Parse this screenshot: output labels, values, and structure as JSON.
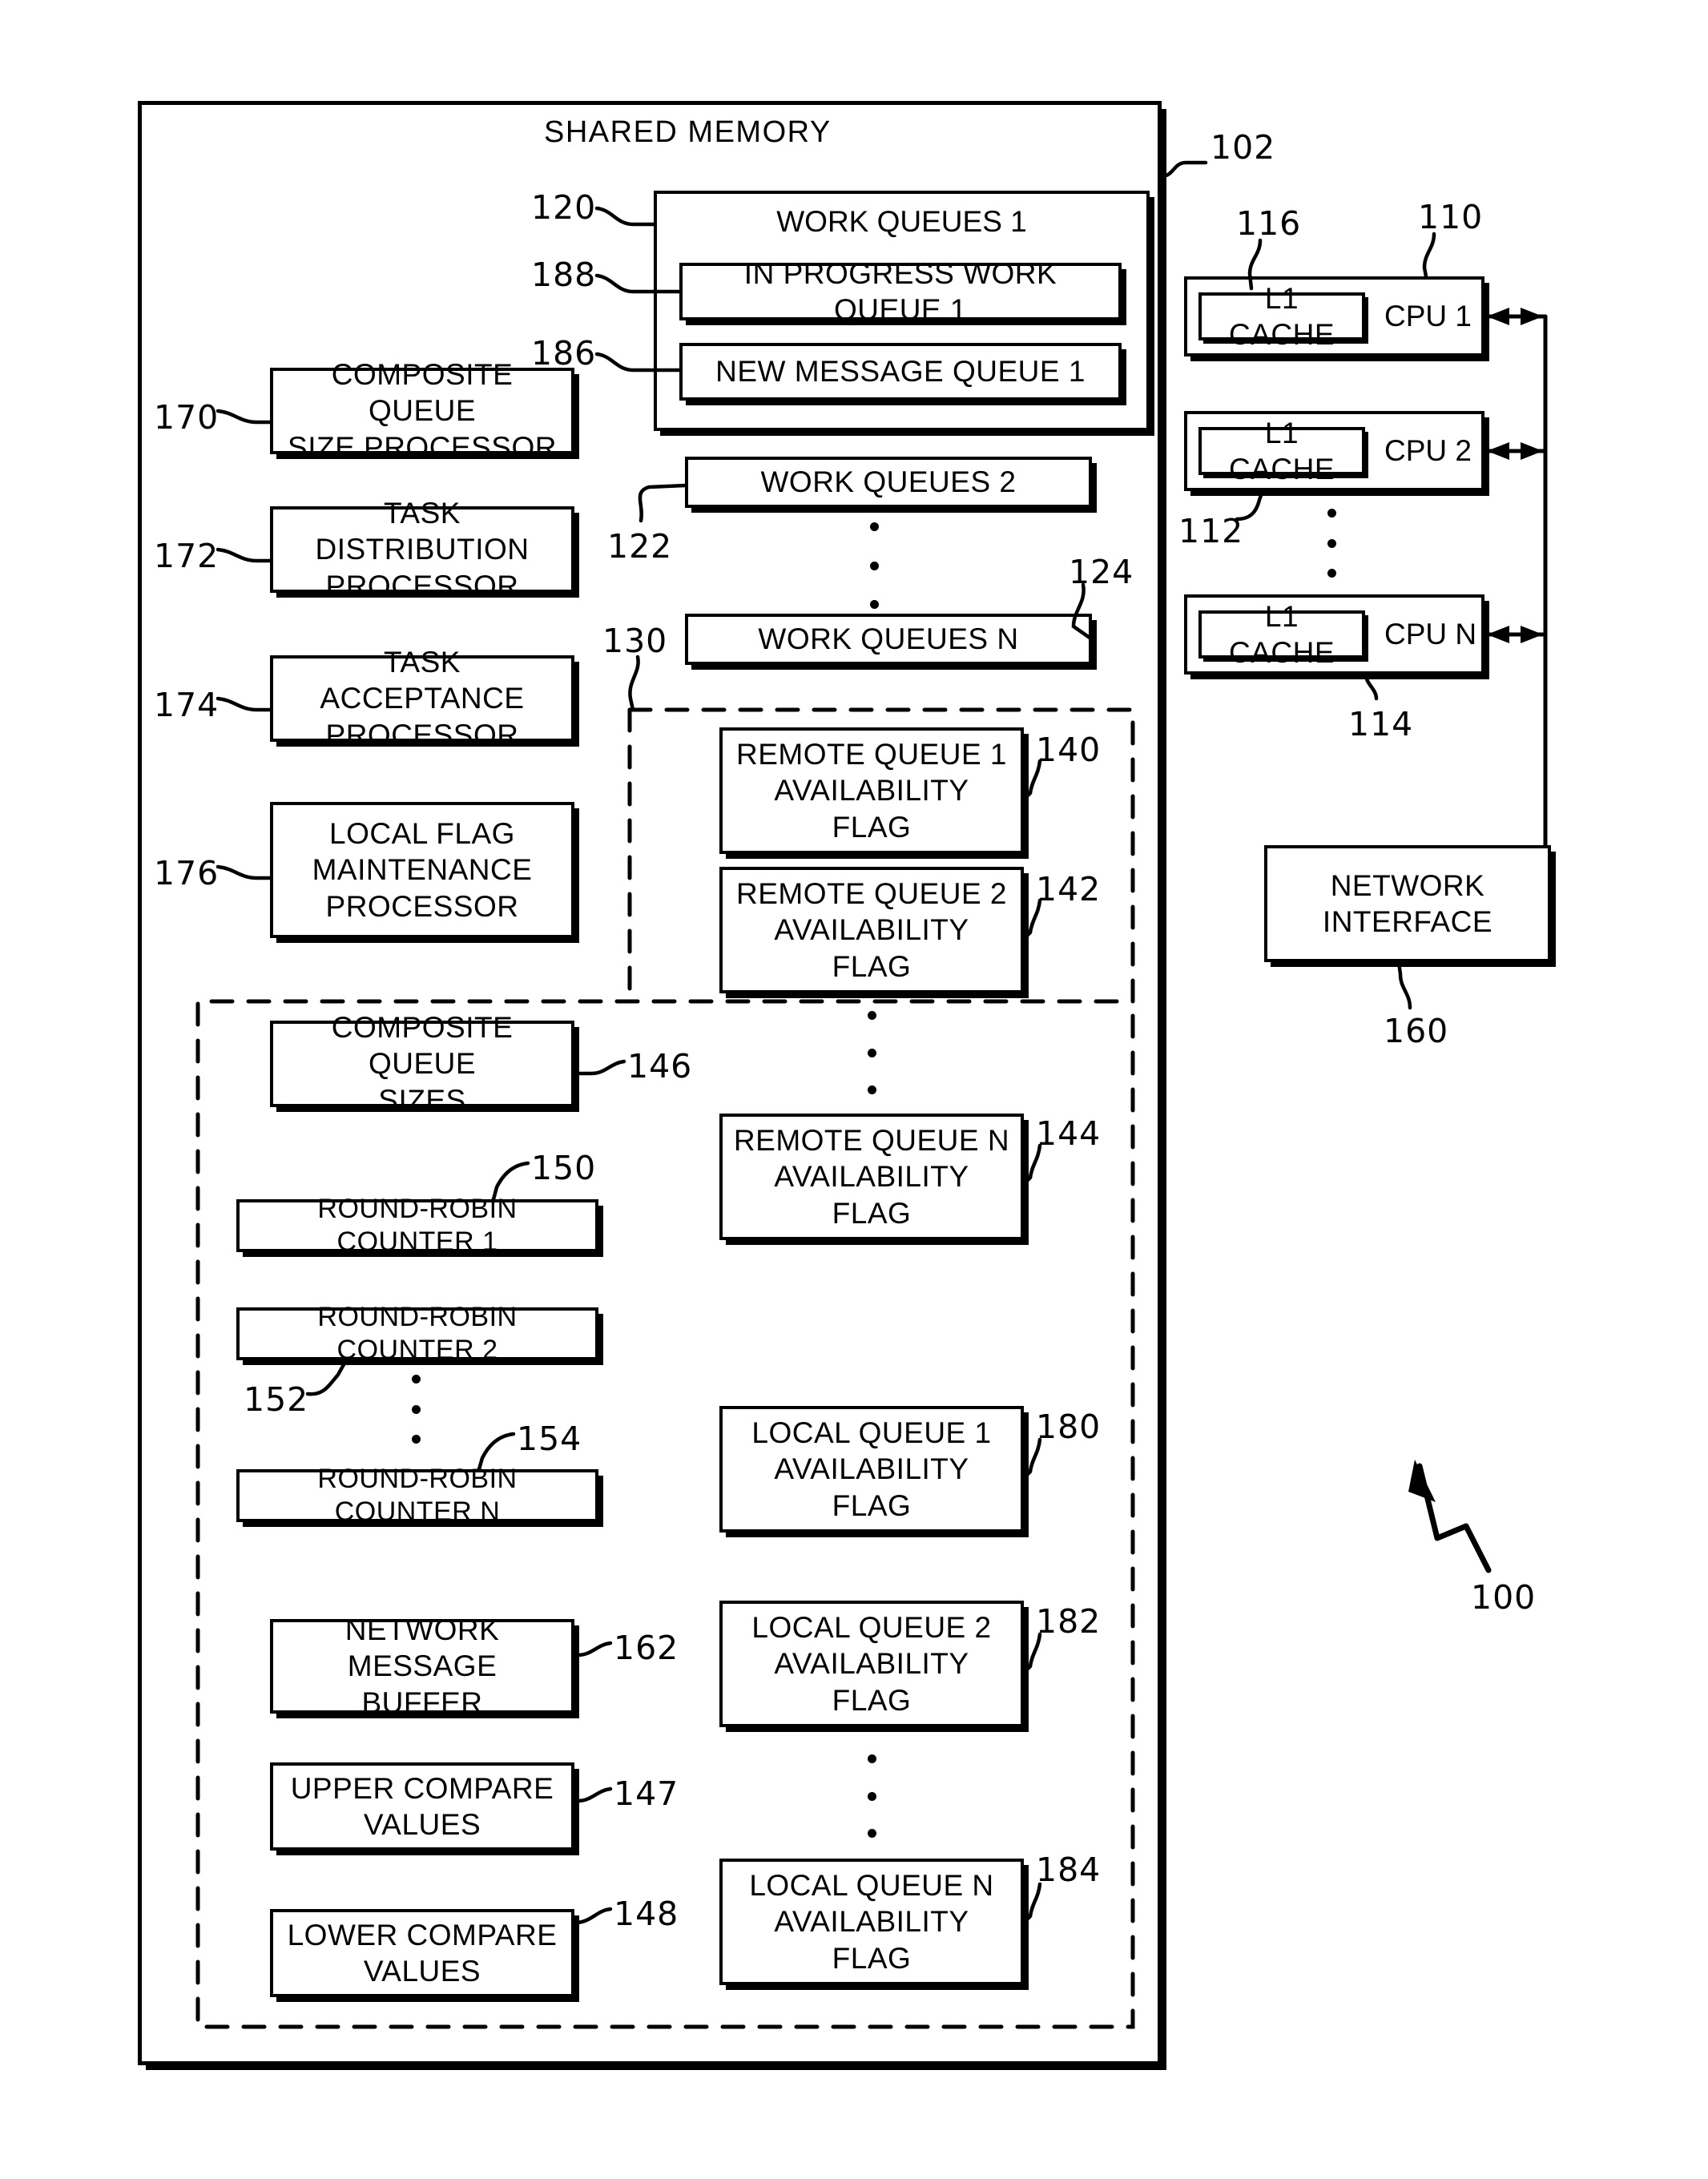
{
  "figure": {
    "system_ref": "100",
    "shared_memory_caption": "SHARED MEMORY",
    "shared_memory_ref": "102"
  },
  "work_queues": {
    "group1": {
      "title": "WORK QUEUES 1",
      "ref": "120",
      "in_progress": {
        "label": "IN PROGRESS WORK QUEUE 1",
        "ref": "188"
      },
      "new_message": {
        "label": "NEW MESSAGE QUEUE 1",
        "ref": "186"
      }
    },
    "group2": {
      "label": "WORK QUEUES 2",
      "ref": "122"
    },
    "groupN": {
      "label": "WORK QUEUES N",
      "ref": "124"
    }
  },
  "processors": [
    {
      "label": "COMPOSITE QUEUE\nSIZE PROCESSOR",
      "ref": "170"
    },
    {
      "label": "TASK DISTRIBUTION\nPROCESSOR",
      "ref": "172"
    },
    {
      "label": "TASK ACCEPTANCE\nPROCESSOR",
      "ref": "174"
    },
    {
      "label": "LOCAL FLAG\nMAINTENANCE\nPROCESSOR",
      "ref": "176"
    }
  ],
  "data_structures": {
    "region_ref": "130",
    "left_column": [
      {
        "label": "COMPOSITE QUEUE\nSIZES",
        "ref": "146"
      },
      {
        "label": "ROUND-ROBIN COUNTER 1",
        "ref": "150"
      },
      {
        "label": "ROUND-ROBIN COUNTER 2",
        "ref": "152"
      },
      {
        "label": "ROUND-ROBIN COUNTER N",
        "ref": "154"
      },
      {
        "label": "NETWORK MESSAGE\nBUFFER",
        "ref": "162"
      },
      {
        "label": "UPPER COMPARE\nVALUES",
        "ref": "147"
      },
      {
        "label": "LOWER COMPARE\nVALUES",
        "ref": "148"
      }
    ],
    "remote_flags": [
      {
        "label": "REMOTE QUEUE 1\nAVAILABILITY\nFLAG",
        "ref": "140"
      },
      {
        "label": "REMOTE QUEUE 2\nAVAILABILITY\nFLAG",
        "ref": "142"
      },
      {
        "label": "REMOTE QUEUE N\nAVAILABILITY\nFLAG",
        "ref": "144"
      }
    ],
    "local_flags": [
      {
        "label": "LOCAL QUEUE 1\nAVAILABILITY\nFLAG",
        "ref": "180"
      },
      {
        "label": "LOCAL QUEUE 2\nAVAILABILITY\nFLAG",
        "ref": "182"
      },
      {
        "label": "LOCAL QUEUE N\nAVAILABILITY\nFLAG",
        "ref": "184"
      }
    ]
  },
  "cpus": {
    "cache_label": "L1 CACHE",
    "cache_ref": "116",
    "cpu1": {
      "label": "CPU 1",
      "ref": "110"
    },
    "cpu2": {
      "label": "CPU 2",
      "ref": "112"
    },
    "cpuN": {
      "label": "CPU N",
      "ref": "114"
    }
  },
  "network_interface": {
    "label": "NETWORK\nINTERFACE",
    "ref": "160"
  }
}
